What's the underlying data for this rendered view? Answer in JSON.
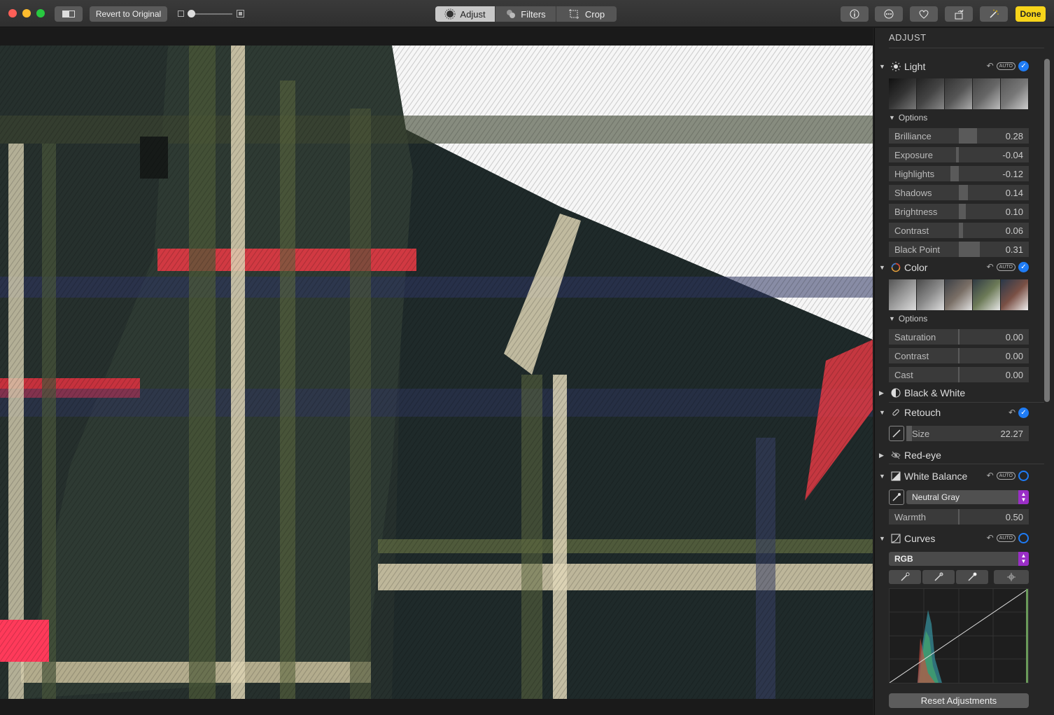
{
  "toolbar": {
    "revert_label": "Revert to Original",
    "tabs": [
      "Adjust",
      "Filters",
      "Crop"
    ],
    "active_tab": "Adjust",
    "done_label": "Done"
  },
  "panel": {
    "title": "ADJUST",
    "light": {
      "label": "Light",
      "auto": "AUTO",
      "options_label": "Options",
      "rows": [
        {
          "label": "Brilliance",
          "value": "0.28"
        },
        {
          "label": "Exposure",
          "value": "-0.04"
        },
        {
          "label": "Highlights",
          "value": "-0.12"
        },
        {
          "label": "Shadows",
          "value": "0.14"
        },
        {
          "label": "Brightness",
          "value": "0.10"
        },
        {
          "label": "Contrast",
          "value": "0.06"
        },
        {
          "label": "Black Point",
          "value": "0.31"
        }
      ]
    },
    "color": {
      "label": "Color",
      "auto": "AUTO",
      "options_label": "Options",
      "rows": [
        {
          "label": "Saturation",
          "value": "0.00"
        },
        {
          "label": "Contrast",
          "value": "0.00"
        },
        {
          "label": "Cast",
          "value": "0.00"
        }
      ]
    },
    "bw": {
      "label": "Black & White"
    },
    "retouch": {
      "label": "Retouch",
      "size_label": "Size",
      "size_value": "22.27"
    },
    "redeye": {
      "label": "Red-eye"
    },
    "white_balance": {
      "label": "White Balance",
      "auto": "AUTO",
      "mode": "Neutral Gray",
      "warmth_label": "Warmth",
      "warmth_value": "0.50"
    },
    "curves": {
      "label": "Curves",
      "auto": "AUTO",
      "channel": "RGB"
    },
    "reset_label": "Reset Adjustments"
  }
}
